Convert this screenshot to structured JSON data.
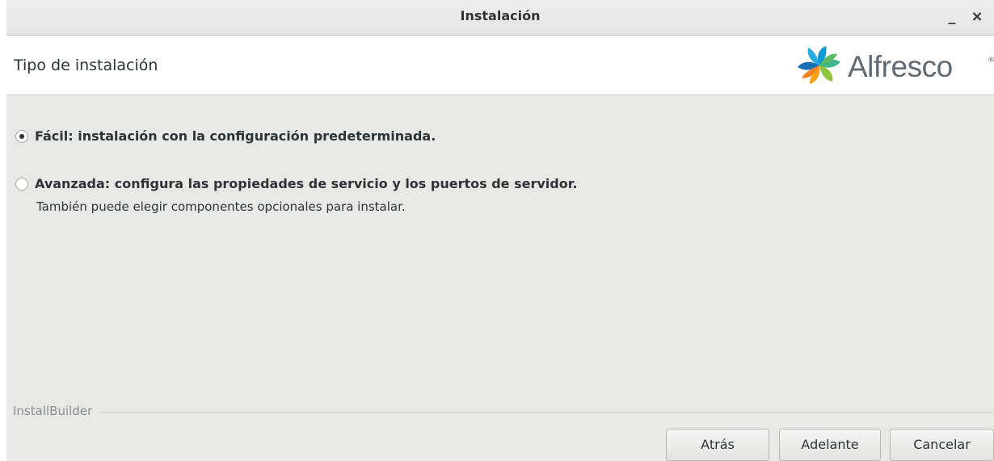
{
  "window": {
    "title": "Instalación",
    "minimize_glyph": "_",
    "close_glyph": "×"
  },
  "header": {
    "title": "Tipo de instalación",
    "logo_text": "Alfresco",
    "logo_reg": "®",
    "logo_icon": "alfresco-flower-icon",
    "logo_colors": [
      "#0b9bd7",
      "#3fb58b",
      "#8cc63f",
      "#f7a21b",
      "#1b6db3"
    ]
  },
  "options": [
    {
      "label": "Fácil: instalación con la configuración predeterminada.",
      "selected": true
    },
    {
      "label": "Avanzada: configura las propiedades de servicio y los puertos de servidor.",
      "selected": false,
      "description": "También puede elegir componentes opcionales para instalar."
    }
  ],
  "footer": {
    "brand": "InstallBuilder",
    "buttons": {
      "back": "Atrás",
      "next": "Adelante",
      "cancel": "Cancelar"
    }
  }
}
